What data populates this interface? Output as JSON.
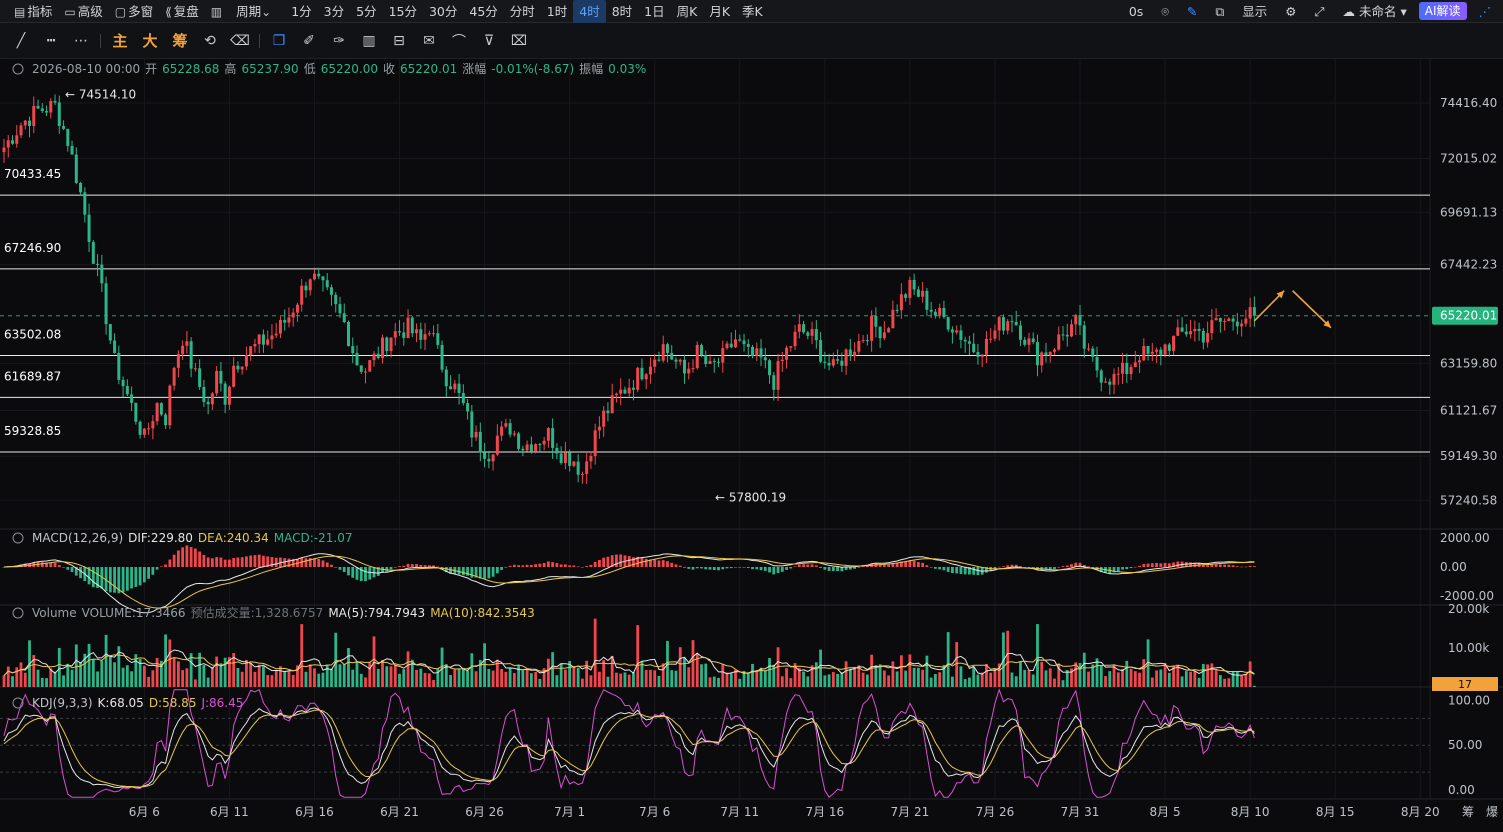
{
  "topbar": {
    "items": [
      {
        "label": "指标",
        "icon": "chart-icon"
      },
      {
        "label": "高级",
        "icon": "calendar-icon"
      },
      {
        "label": "多窗",
        "icon": "window-icon"
      },
      {
        "label": "复盘",
        "icon": "replay-icon"
      },
      {
        "label": "",
        "icon": "chart-type-icon"
      },
      {
        "label": "周期",
        "icon": "chevron-down-icon"
      }
    ],
    "periods": [
      "1分",
      "3分",
      "5分",
      "15分",
      "30分",
      "45分",
      "分时",
      "1时",
      "4时",
      "8时",
      "1日",
      "周K",
      "月K",
      "季K"
    ],
    "active_period": "4时",
    "right": {
      "countdown": "0s",
      "display_label": "显示",
      "layout_name": "未命名",
      "ai_label": "AI解读"
    }
  },
  "drawing_tools": {
    "text_buttons": [
      "主",
      "大",
      "筹"
    ]
  },
  "colors": {
    "up": "#f0474d",
    "down": "#2cb589",
    "dif": "#e6e6e6",
    "dea": "#e6c74a",
    "ma5": "#e6e6e6",
    "ma10": "#e6c74a",
    "k": "#e6e6e6",
    "d": "#e6c74a",
    "j": "#d94fd4",
    "arrow": "#f2a23a",
    "last_price_bg": "#24b47e",
    "vol_tag_bg": "#f2a23a"
  },
  "chart_data": {
    "type": "candlestick",
    "symbol_info": {
      "datetime": "2026-08-10 00:00",
      "open_label": "开",
      "open": "65228.68",
      "high_label": "高",
      "high": "65237.90",
      "low_label": "低",
      "low": "65220.00",
      "close_label": "收",
      "close": "65220.01",
      "change_label": "涨幅",
      "change": "-0.01%(-8.67)",
      "amp_label": "振幅",
      "amp": "0.03%"
    },
    "price_axis": {
      "ymin": 56000,
      "ymax": 75800,
      "ticks": [
        "74416.40",
        "72015.02",
        "69691.13",
        "67442.23",
        "63159.80",
        "61121.67",
        "59149.30",
        "57240.58"
      ]
    },
    "last_price": "65220.01",
    "last_price_value": 65220.01,
    "horizontal_lines": [
      {
        "label": "70433.45",
        "value": 70433.45
      },
      {
        "label": "67246.90",
        "value": 67246.9
      },
      {
        "label": "63502.08",
        "value": 63502.08
      },
      {
        "label": "61689.87",
        "value": 61689.87
      },
      {
        "label": "59328.85",
        "value": 59328.85
      }
    ],
    "extremes": [
      {
        "label": "← 74514.10",
        "value": 74514.1,
        "bar": 12
      },
      {
        "label": "← 57800.19",
        "value": 57800.19,
        "bar": 166
      }
    ],
    "x_ticks": [
      {
        "label": "6月 6",
        "bar": 33
      },
      {
        "label": "6月 11",
        "bar": 53
      },
      {
        "label": "6月 16",
        "bar": 73
      },
      {
        "label": "6月 21",
        "bar": 93
      },
      {
        "label": "6月 26",
        "bar": 113
      },
      {
        "label": "7月 1",
        "bar": 133
      },
      {
        "label": "7月 6",
        "bar": 153
      },
      {
        "label": "7月 11",
        "bar": 173
      },
      {
        "label": "7月 16",
        "bar": 193
      },
      {
        "label": "7月 21",
        "bar": 213
      },
      {
        "label": "7月 26",
        "bar": 233
      },
      {
        "label": "7月 31",
        "bar": 253
      },
      {
        "label": "8月 5",
        "bar": 273
      },
      {
        "label": "8月 10",
        "bar": 293
      },
      {
        "label": "8月 15",
        "bar": 313
      },
      {
        "label": "8月 20",
        "bar": 333
      }
    ],
    "x_axis_right": [
      "筹",
      "爆"
    ],
    "anchor_closes": [
      [
        0,
        72500
      ],
      [
        4,
        73500
      ],
      [
        8,
        74100
      ],
      [
        12,
        74300
      ],
      [
        15,
        72800
      ],
      [
        18,
        70500
      ],
      [
        20,
        68700
      ],
      [
        23,
        66200
      ],
      [
        26,
        63200
      ],
      [
        30,
        61300
      ],
      [
        33,
        59900
      ],
      [
        36,
        61400
      ],
      [
        38,
        60800
      ],
      [
        40,
        63100
      ],
      [
        42,
        64300
      ],
      [
        45,
        62600
      ],
      [
        48,
        61300
      ],
      [
        50,
        62600
      ],
      [
        52,
        61700
      ],
      [
        54,
        63100
      ],
      [
        57,
        63600
      ],
      [
        60,
        64000
      ],
      [
        64,
        64500
      ],
      [
        67,
        65200
      ],
      [
        70,
        66300
      ],
      [
        72,
        67000
      ],
      [
        74,
        66600
      ],
      [
        77,
        65800
      ],
      [
        80,
        64900
      ],
      [
        83,
        63200
      ],
      [
        85,
        62900
      ],
      [
        88,
        63600
      ],
      [
        91,
        64400
      ],
      [
        95,
        64700
      ],
      [
        98,
        64100
      ],
      [
        100,
        64800
      ],
      [
        102,
        63600
      ],
      [
        104,
        62600
      ],
      [
        106,
        62100
      ],
      [
        108,
        61300
      ],
      [
        110,
        60200
      ],
      [
        112,
        59600
      ],
      [
        114,
        59300
      ],
      [
        116,
        60000
      ],
      [
        119,
        60400
      ],
      [
        122,
        59600
      ],
      [
        125,
        59800
      ],
      [
        128,
        60100
      ],
      [
        131,
        59300
      ],
      [
        134,
        59000
      ],
      [
        136,
        58400
      ],
      [
        138,
        59600
      ],
      [
        141,
        60900
      ],
      [
        145,
        61900
      ],
      [
        148,
        62400
      ],
      [
        152,
        63300
      ],
      [
        155,
        63900
      ],
      [
        158,
        63200
      ],
      [
        160,
        62700
      ],
      [
        163,
        63600
      ],
      [
        166,
        62900
      ],
      [
        169,
        63400
      ],
      [
        172,
        64200
      ],
      [
        175,
        63500
      ],
      [
        178,
        63300
      ],
      [
        181,
        62400
      ],
      [
        184,
        63700
      ],
      [
        187,
        64600
      ],
      [
        190,
        64300
      ],
      [
        193,
        63300
      ],
      [
        195,
        62900
      ],
      [
        198,
        63600
      ],
      [
        201,
        64100
      ],
      [
        204,
        64800
      ],
      [
        207,
        64600
      ],
      [
        210,
        65700
      ],
      [
        213,
        66400
      ],
      [
        216,
        66000
      ],
      [
        219,
        65300
      ],
      [
        222,
        65000
      ],
      [
        225,
        64400
      ],
      [
        228,
        63800
      ],
      [
        231,
        64000
      ],
      [
        234,
        64800
      ],
      [
        237,
        65200
      ],
      [
        240,
        64300
      ],
      [
        243,
        63500
      ],
      [
        246,
        63800
      ],
      [
        249,
        64400
      ],
      [
        252,
        64900
      ],
      [
        255,
        63400
      ],
      [
        258,
        62700
      ],
      [
        261,
        62500
      ],
      [
        264,
        62900
      ],
      [
        267,
        63600
      ],
      [
        270,
        63400
      ],
      [
        273,
        63900
      ],
      [
        276,
        64300
      ],
      [
        279,
        64700
      ],
      [
        282,
        64400
      ],
      [
        285,
        64900
      ],
      [
        288,
        65000
      ],
      [
        291,
        65200
      ],
      [
        294,
        65220
      ]
    ],
    "bars": 295,
    "projection_arrows": [
      {
        "from_bar": 294,
        "from_value": 65000,
        "to_bar": 301,
        "to_value": 66300
      },
      {
        "from_bar": 303,
        "from_value": 66300,
        "to_bar": 312,
        "to_value": 64700
      }
    ],
    "macd": {
      "label": "MACD(12,26,9)",
      "dif_label": "DIF:229.80",
      "dea_label": "DEA:240.34",
      "macd_label": "MACD:-21.07",
      "ticks": [
        "2000.00",
        "0.00",
        "-2000.00"
      ],
      "ymin": -2600,
      "ymax": 2600
    },
    "volume": {
      "label": "Volume",
      "volume_label": "VOLUME:17.3466",
      "est_label": "预估成交量:1,328.6757",
      "ma5_label": "MA(5):794.7943",
      "ma10_label": "MA(10):842.3543",
      "ticks": [
        "20.00k",
        "10.00k"
      ],
      "tag": "17",
      "ymax": 21000
    },
    "kdj": {
      "label": "KDJ(9,3,3)",
      "k_label": "K:68.05",
      "d_label": "D:58.85",
      "j_label": "J:86.45",
      "ticks": [
        "100.00",
        "50.00",
        "0.00"
      ],
      "ymin": -10,
      "ymax": 115,
      "ref_lines": [
        80,
        50,
        20
      ]
    }
  }
}
